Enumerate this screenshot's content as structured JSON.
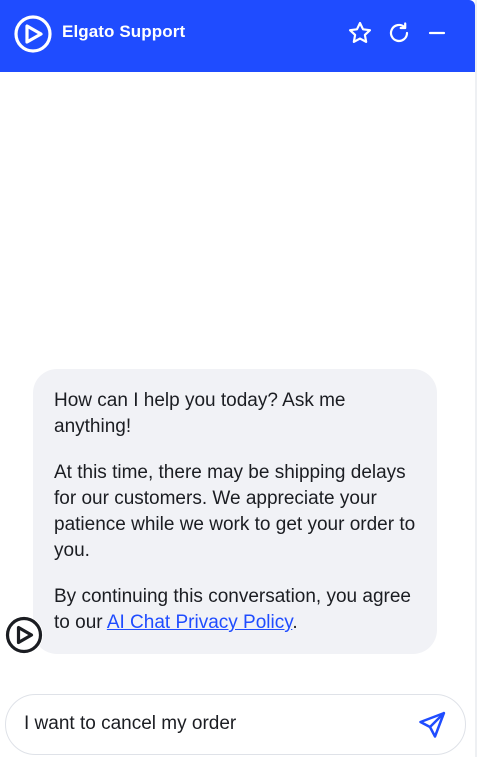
{
  "header": {
    "title": "Elgato Support",
    "bg_color": "#1f4cff",
    "icons": {
      "logo": "elgato-logo-icon",
      "favorite": "star-icon",
      "restart": "refresh-icon",
      "minimize": "minus-icon"
    }
  },
  "chat": {
    "messages": [
      {
        "sender": "bot",
        "paragraphs": [
          "How can I help you today? Ask me anything!",
          "At this time, there may be shipping delays for our customers. We appreciate your patience while we work to get your order to you."
        ],
        "consent_prefix": "By continuing this conversation, you agree to our ",
        "consent_link": "AI Chat Privacy Policy",
        "consent_suffix": "."
      }
    ]
  },
  "composer": {
    "value": "I want to cancel my order",
    "send_icon": "send-icon"
  },
  "colors": {
    "accent": "#1f4cff",
    "bubble_bg": "#f1f2f6",
    "text": "#1b1d22"
  }
}
